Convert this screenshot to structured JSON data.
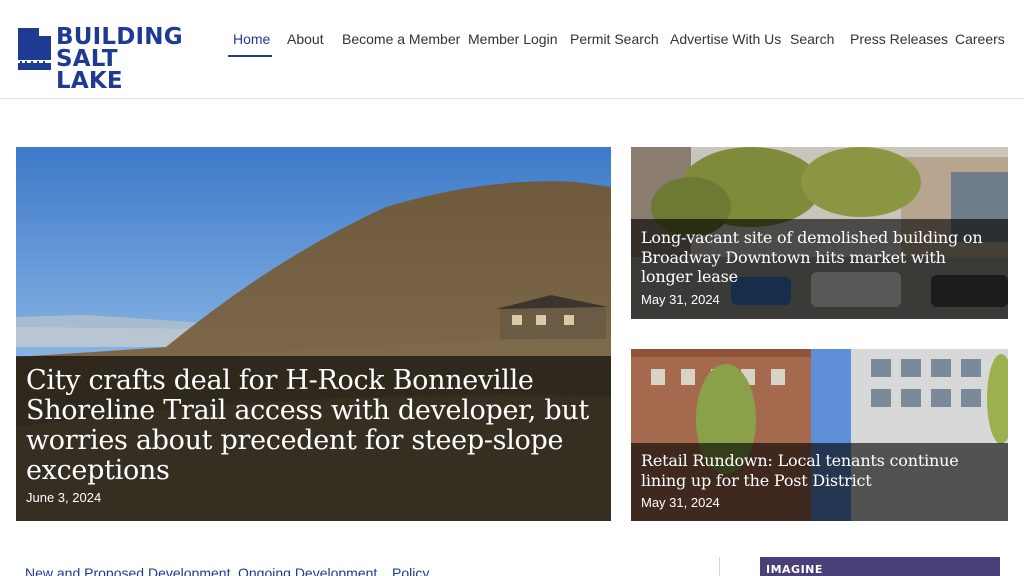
{
  "site": {
    "logo_line1": "BUILDING",
    "logo_line2": "SALT LAKE",
    "brand_color": "#1f3a93"
  },
  "nav": {
    "items": [
      {
        "label": "Home",
        "active": true
      },
      {
        "label": "About"
      },
      {
        "label": "Become a Member"
      },
      {
        "label": "Member Login"
      },
      {
        "label": "Permit Search"
      },
      {
        "label": "Advertise With Us"
      },
      {
        "label": "Search"
      },
      {
        "label": "Press Releases"
      },
      {
        "label": "Careers"
      }
    ]
  },
  "featured": {
    "main": {
      "headline": "City crafts deal for H-Rock Bonneville Shoreline Trail access with developer, but worries about precedent for steep-slope exceptions",
      "date": "June 3, 2024"
    },
    "side": [
      {
        "headline": "Long-vacant site of demolished building on Broadway Downtown hits market with longer lease",
        "date": "May 31, 2024"
      },
      {
        "headline": "Retail Rundown: Local tenants continue lining up for the Post District",
        "date": "May 31, 2024"
      }
    ]
  },
  "tabs": {
    "items": [
      {
        "label": "New and Proposed Development"
      },
      {
        "label": "Ongoing Development"
      },
      {
        "label": "Policy"
      }
    ]
  },
  "ad": {
    "text": "IMAGINE"
  }
}
